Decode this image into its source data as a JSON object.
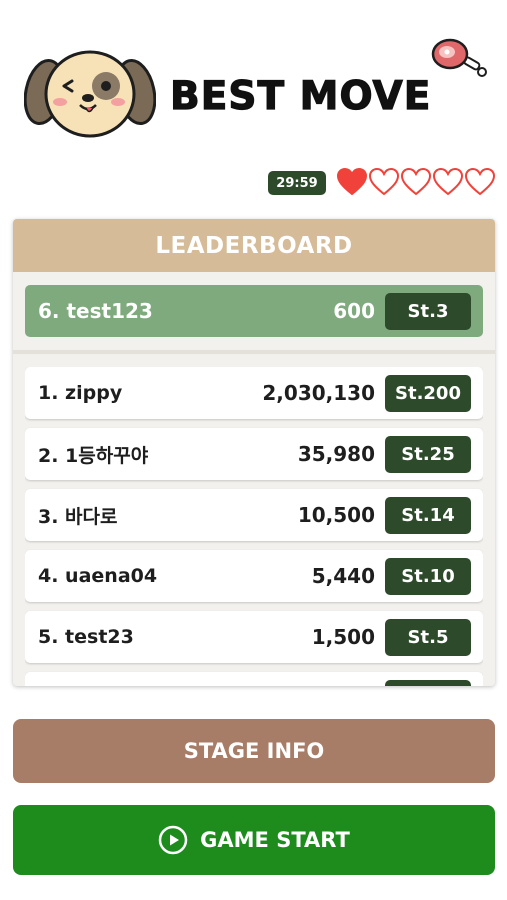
{
  "header": {
    "title": "BEST MOVE",
    "logo_icon": "dog-face-icon",
    "decor_icon": "meat-icon"
  },
  "status": {
    "timer": "29:59",
    "lives_total": 5,
    "lives_filled": 1,
    "heart_color": "#f0423a"
  },
  "leaderboard": {
    "title": "LEADERBOARD",
    "my_entry": {
      "name": "6. test123",
      "score": "600",
      "stage": "St.3"
    },
    "entries": [
      {
        "name": "1. zippy",
        "score": "2,030,130",
        "stage": "St.200"
      },
      {
        "name": "2. 1등하꾸야",
        "score": "35,980",
        "stage": "St.25"
      },
      {
        "name": "3. 바다로",
        "score": "10,500",
        "stage": "St.14"
      },
      {
        "name": "4. uaena04",
        "score": "5,440",
        "stage": "St.10"
      },
      {
        "name": "5. test23",
        "score": "1,500",
        "stage": "St.5"
      },
      {
        "name": "",
        "score": "",
        "stage": ""
      }
    ]
  },
  "buttons": {
    "stage_info": "STAGE INFO",
    "game_start": "GAME START",
    "game_start_icon": "play-circle-icon"
  },
  "colors": {
    "header_tan": "#d6bb98",
    "my_row_green": "#7faa7d",
    "badge_dark_green": "#2d4a2b",
    "stage_button": "#a87d68",
    "start_button": "#1d8c1d"
  }
}
